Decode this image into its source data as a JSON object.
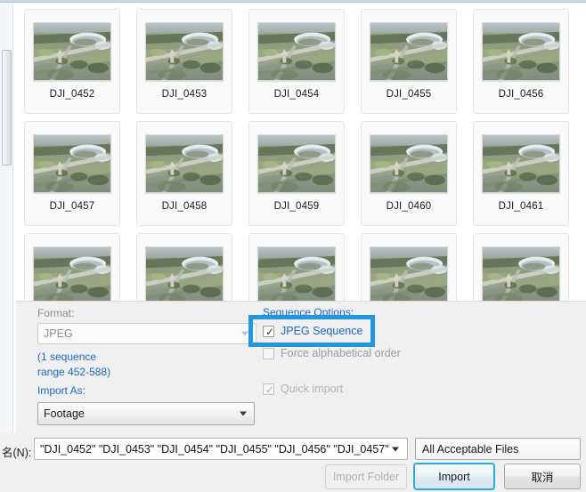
{
  "browser": {
    "thumbnails": [
      {
        "label": "DJI_0452"
      },
      {
        "label": "DJI_0453"
      },
      {
        "label": "DJI_0454"
      },
      {
        "label": "DJI_0455"
      },
      {
        "label": "DJI_0456"
      },
      {
        "label": "DJI_0457"
      },
      {
        "label": "DJI_0458"
      },
      {
        "label": "DJI_0459"
      },
      {
        "label": "DJI_0460"
      },
      {
        "label": "DJI_0461"
      },
      {
        "label": ""
      },
      {
        "label": ""
      },
      {
        "label": ""
      },
      {
        "label": ""
      },
      {
        "label": ""
      }
    ]
  },
  "options": {
    "format_label": "Format:",
    "format_value": "JPEG",
    "sequence_info_line1": "(1 sequence",
    "sequence_info_line2": "range 452-588)",
    "import_as_label": "Import As:",
    "import_as_value": "Footage",
    "sequence_options_label": "Sequence Options:",
    "jpeg_sequence_label": "JPEG Sequence",
    "jpeg_sequence_checked": "checked",
    "force_alpha_label": "Force alphabetical order",
    "force_alpha_checked": "unchecked",
    "quick_import_label": "Quick import",
    "quick_import_checked": "checked"
  },
  "bottom": {
    "filename_label": "名(N):",
    "filename_value": "\"DJI_0452\" \"DJI_0453\" \"DJI_0454\" \"DJI_0455\" \"DJI_0456\" \"DJI_0457\"",
    "filetype_value": "All Acceptable Files",
    "import_folder_label": "Import Folder",
    "import_label": "Import",
    "cancel_label": "取消"
  },
  "colors": {
    "accent_blue": "#1b68c6",
    "annotation_blue": "#2196e3",
    "focus_ring": "#2aaae0",
    "panel_bg": "#f0f0f0"
  },
  "icons": {
    "checkmark": "✓",
    "dropdown_arrow": "▼"
  }
}
